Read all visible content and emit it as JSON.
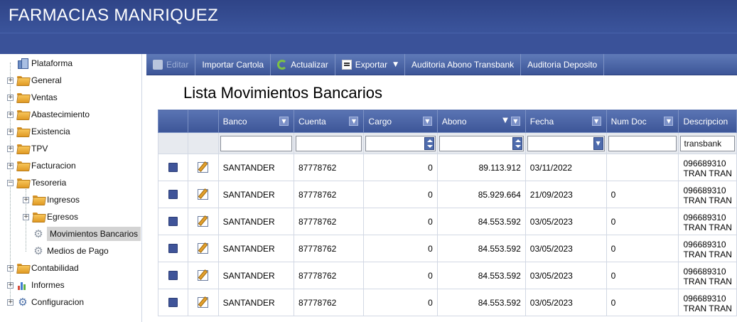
{
  "app": {
    "title": "FARMACIAS MANRIQUEZ"
  },
  "sidebar": {
    "items": [
      {
        "label": "Plataforma",
        "icon": "platform-icon"
      },
      {
        "label": "General",
        "icon": "folder-icon"
      },
      {
        "label": "Ventas",
        "icon": "folder-icon"
      },
      {
        "label": "Abastecimiento",
        "icon": "folder-icon"
      },
      {
        "label": "Existencia",
        "icon": "folder-icon"
      },
      {
        "label": "TPV",
        "icon": "folder-icon"
      },
      {
        "label": "Facturacion",
        "icon": "folder-icon"
      },
      {
        "label": "Tesoreria",
        "icon": "folder-icon"
      },
      {
        "label": "Ingresos",
        "icon": "folder-icon"
      },
      {
        "label": "Egresos",
        "icon": "folder-icon"
      },
      {
        "label": "Movimientos Bancarios",
        "icon": "gear-icon"
      },
      {
        "label": "Medios de Pago",
        "icon": "gear-icon"
      },
      {
        "label": "Contabilidad",
        "icon": "folder-icon"
      },
      {
        "label": "Informes",
        "icon": "chart-icon"
      },
      {
        "label": "Configuracion",
        "icon": "gear-icon"
      }
    ]
  },
  "toolbar": {
    "editar": "Editar",
    "importar": "Importar Cartola",
    "actualizar": "Actualizar",
    "exportar": "Exportar",
    "auditoria_abono": "Auditoria Abono Transbank",
    "auditoria_deposito": "Auditoria Deposito"
  },
  "list_title": "Lista Movimientos Bancarios",
  "grid": {
    "columns": [
      "Banco",
      "Cuenta",
      "Cargo",
      "Abono",
      "Fecha",
      "Num Doc",
      "Descripcion"
    ],
    "sort_column": "Abono",
    "filters": {
      "descripcion": "transbank"
    },
    "rows": [
      {
        "banco": "SANTANDER",
        "cuenta": "87778762",
        "cargo": "0",
        "abono": "89.113.912",
        "fecha": "03/11/2022",
        "num_doc": "",
        "desc1": "096689310",
        "desc2": "TRAN TRAN"
      },
      {
        "banco": "SANTANDER",
        "cuenta": "87778762",
        "cargo": "0",
        "abono": "85.929.664",
        "fecha": "21/09/2023",
        "num_doc": "0",
        "desc1": "096689310",
        "desc2": "TRAN TRAN"
      },
      {
        "banco": "SANTANDER",
        "cuenta": "87778762",
        "cargo": "0",
        "abono": "84.553.592",
        "fecha": "03/05/2023",
        "num_doc": "0",
        "desc1": "096689310",
        "desc2": "TRAN TRAN"
      },
      {
        "banco": "SANTANDER",
        "cuenta": "87778762",
        "cargo": "0",
        "abono": "84.553.592",
        "fecha": "03/05/2023",
        "num_doc": "0",
        "desc1": "096689310",
        "desc2": "TRAN TRAN"
      },
      {
        "banco": "SANTANDER",
        "cuenta": "87778762",
        "cargo": "0",
        "abono": "84.553.592",
        "fecha": "03/05/2023",
        "num_doc": "0",
        "desc1": "096689310",
        "desc2": "TRAN TRAN"
      },
      {
        "banco": "SANTANDER",
        "cuenta": "87778762",
        "cargo": "0",
        "abono": "84.553.592",
        "fecha": "03/05/2023",
        "num_doc": "0",
        "desc1": "096689310",
        "desc2": "TRAN TRAN"
      }
    ]
  }
}
